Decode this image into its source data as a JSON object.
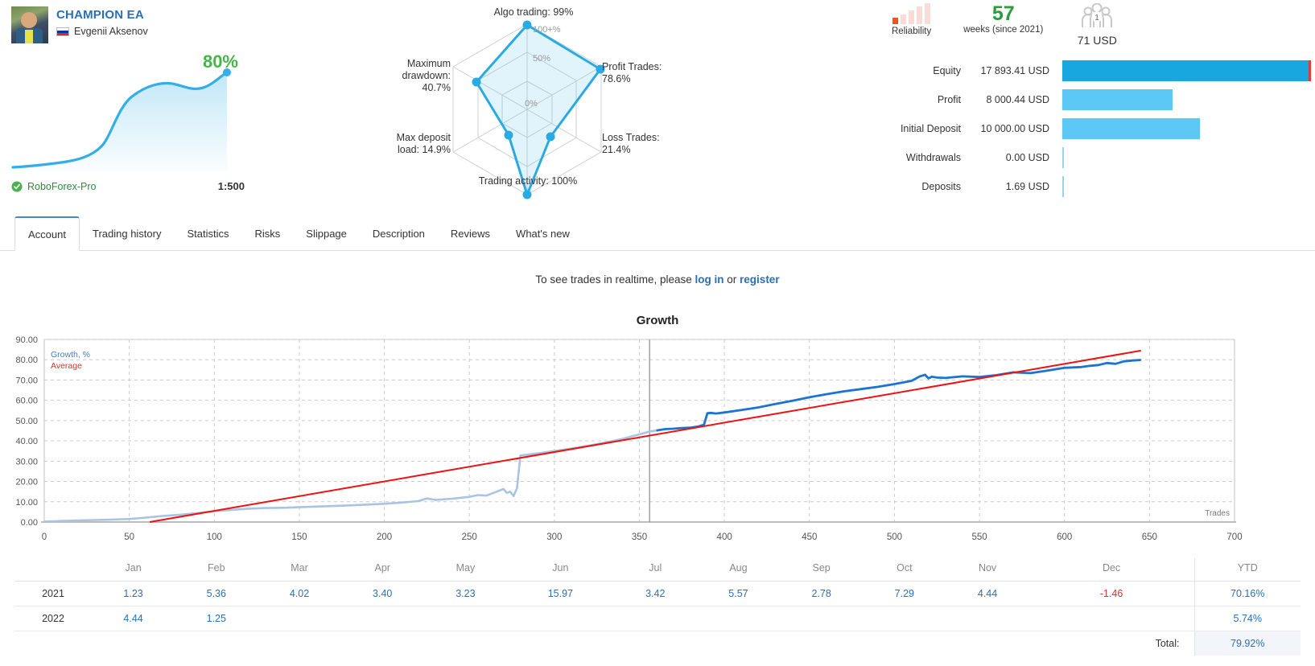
{
  "header": {
    "ea_title": "CHAMPION EA",
    "owner_name": "Evgenii Aksenov",
    "flag_icon": "flag-russia-icon",
    "mini_percent": "80%",
    "broker": "RoboForex-Pro",
    "leverage": "1:500",
    "verified_icon": "shield-check-icon"
  },
  "radar": {
    "labels": {
      "algo_trading": "Algo trading: 99%",
      "profit_trades": "Profit Trades: 78.6%",
      "loss_trades": "Loss Trades: 21.4%",
      "trading_activity": "Trading activity: 100%",
      "max_deposit_load": "Max deposit load: 14.9%",
      "maximum_drawdown": "Maximum drawdown: 40.7%"
    },
    "rings": {
      "outer": "100+%",
      "middle": "50%",
      "inner": "0%"
    }
  },
  "badges": {
    "reliability_label": "Reliability",
    "reliability_filled": 1,
    "reliability_total": 5,
    "weeks_number": "57",
    "weeks_caption": "weeks (since 2021)",
    "subscribers_count": "1",
    "subscribers_price": "71 USD",
    "subscribers_icon": "people-group-icon"
  },
  "stats": [
    {
      "label": "Equity",
      "value": "17 893.41 USD",
      "pct": 100,
      "style": "dark"
    },
    {
      "label": "Profit",
      "value": "8 000.44 USD",
      "pct": 44.7,
      "style": "light"
    },
    {
      "label": "Initial Deposit",
      "value": "10 000.00 USD",
      "pct": 55.9,
      "style": "light"
    },
    {
      "label": "Withdrawals",
      "value": "0.00 USD",
      "pct": 0,
      "style": "tick"
    },
    {
      "label": "Deposits",
      "value": "1.69 USD",
      "pct": 0,
      "style": "tick"
    }
  ],
  "tabs": [
    {
      "label": "Account",
      "active": true
    },
    {
      "label": "Trading history",
      "active": false
    },
    {
      "label": "Statistics",
      "active": false
    },
    {
      "label": "Risks",
      "active": false
    },
    {
      "label": "Slippage",
      "active": false
    },
    {
      "label": "Description",
      "active": false
    },
    {
      "label": "Reviews",
      "active": false
    },
    {
      "label": "What's new",
      "active": false
    }
  ],
  "notice": {
    "prefix": "To see trades in realtime, please ",
    "login": "log in",
    "middle": " or ",
    "register": "register"
  },
  "colors": {
    "accent_blue": "#2a6fb5",
    "growth_blue": "#1b73d4",
    "growth_blue_faded": "#a8c4e2",
    "average_red": "#ee1111",
    "green": "#2a9c3e",
    "bar_light": "#5bc8f5",
    "bar_dark": "#19a7e0",
    "reliability_on": "#f4511e"
  },
  "chart_data": {
    "type": "line",
    "title": "Growth",
    "xlabel": "Trades",
    "ylabel": "Growth, %",
    "xlim": [
      0,
      700
    ],
    "ylim": [
      0,
      90
    ],
    "xticks": [
      0,
      50,
      100,
      150,
      200,
      250,
      300,
      350,
      400,
      450,
      500,
      550,
      600,
      650,
      700
    ],
    "yticks": [
      "0.00",
      "10.00",
      "20.00",
      "30.00",
      "40.00",
      "50.00",
      "60.00",
      "70.00",
      "80.00",
      "90.00"
    ],
    "grid": true,
    "legend": [
      "Growth, %",
      "Average"
    ],
    "legend_position": "top-left-inside",
    "marker_x": 356,
    "series": [
      {
        "name": "Growth, %",
        "color": "#1b73d4",
        "x": [
          0,
          10,
          20,
          30,
          40,
          50,
          60,
          70,
          80,
          90,
          100,
          110,
          120,
          130,
          140,
          150,
          160,
          170,
          180,
          190,
          200,
          210,
          220,
          225,
          230,
          240,
          250,
          255,
          260,
          265,
          270,
          272,
          274,
          276,
          278,
          280,
          290,
          300,
          310,
          320,
          330,
          340,
          350,
          356,
          360,
          365,
          370,
          375,
          380,
          385,
          388,
          390,
          392,
          395,
          400,
          410,
          420,
          430,
          440,
          450,
          460,
          470,
          480,
          490,
          500,
          510,
          515,
          518,
          520,
          522,
          525,
          530,
          540,
          550,
          560,
          570,
          580,
          590,
          600,
          610,
          615,
          620,
          625,
          630,
          635,
          640,
          645
        ],
        "y": [
          0.2,
          0.5,
          0.8,
          1.0,
          1.2,
          1.5,
          2.2,
          3.0,
          3.6,
          4.4,
          5.3,
          6.0,
          6.6,
          6.9,
          7.0,
          7.3,
          7.6,
          7.9,
          8.2,
          8.6,
          9.0,
          9.6,
          10.3,
          11.6,
          10.9,
          11.5,
          12.4,
          13.3,
          13.0,
          14.6,
          16.3,
          14.4,
          15.0,
          12.8,
          16.6,
          32.8,
          33.8,
          35.0,
          36.2,
          37.6,
          39.2,
          41.0,
          43.2,
          44.6,
          45.1,
          45.8,
          46.0,
          46.3,
          46.5,
          47.2,
          48.0,
          53.6,
          53.8,
          53.5,
          54.0,
          55.2,
          56.5,
          58.2,
          59.8,
          61.5,
          63.0,
          64.4,
          65.5,
          66.6,
          68.0,
          69.6,
          71.8,
          72.6,
          70.8,
          71.6,
          71.2,
          71.0,
          71.8,
          71.5,
          72.4,
          73.8,
          73.4,
          74.6,
          76.0,
          76.4,
          77.0,
          77.4,
          78.4,
          78.0,
          79.2,
          79.6,
          79.9
        ],
        "observed_from_x": 356
      },
      {
        "name": "Average",
        "color": "#ee1111",
        "x": [
          62,
          645
        ],
        "y": [
          0,
          84.5
        ]
      }
    ]
  },
  "monthly": {
    "months": [
      "Jan",
      "Feb",
      "Mar",
      "Apr",
      "May",
      "Jun",
      "Jul",
      "Aug",
      "Sep",
      "Oct",
      "Nov",
      "Dec"
    ],
    "ytd_header": "YTD",
    "rows": [
      {
        "year": "2021",
        "values": [
          "1.23",
          "5.36",
          "4.02",
          "3.40",
          "3.23",
          "15.97",
          "3.42",
          "5.57",
          "2.78",
          "7.29",
          "4.44",
          "-1.46"
        ],
        "ytd": "70.16%"
      },
      {
        "year": "2022",
        "values": [
          "4.44",
          "1.25",
          "",
          "",
          "",
          "",
          "",
          "",
          "",
          "",
          "",
          ""
        ],
        "ytd": "5.74%"
      }
    ],
    "total_label": "Total:",
    "total_value": "79.92%"
  }
}
